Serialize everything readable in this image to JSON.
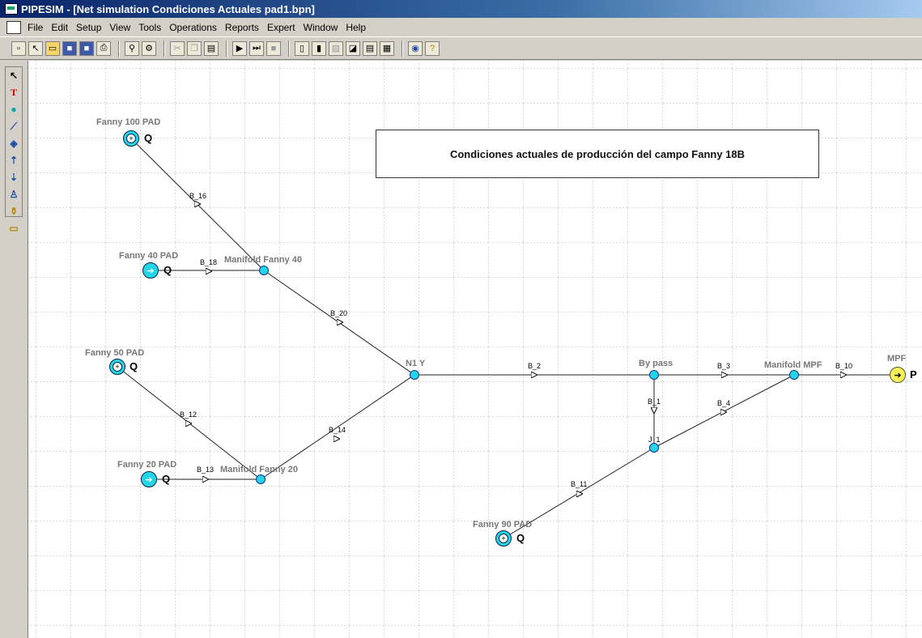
{
  "app": {
    "title": "PIPESIM - [Net simulation Condiciones Actuales pad1.bpn]"
  },
  "menu": [
    "File",
    "Edit",
    "Setup",
    "View",
    "Tools",
    "Operations",
    "Reports",
    "Expert",
    "Window",
    "Help"
  ],
  "toolbar_icons": [
    "new-icon",
    "select-icon",
    "open-icon",
    "save-icon",
    "save-as-icon",
    "print-icon",
    "find-icon",
    "properties-icon",
    "cut-icon",
    "copy-icon",
    "paste-icon",
    "run-icon",
    "run-step-icon",
    "stop-icon",
    "view-1-icon",
    "view-2-icon",
    "view-3-icon",
    "view-4-icon",
    "view-5-icon",
    "table-icon",
    "globe-icon",
    "help-icon"
  ],
  "palette_icons": [
    "pointer-tool-icon",
    "text-tool-icon",
    "junction-tool-icon",
    "branch-tool-icon",
    "source-tool-icon",
    "well-tool-icon",
    "injection-tool-icon",
    "compressor-tool-icon",
    "valve-tool-icon",
    "folder-tool-icon"
  ],
  "palette_text": {
    "text_tool": "T"
  },
  "canvas": {
    "note": "Condiciones actuales de producción del campo Fanny 18B",
    "node_labels": {
      "f100": "Fanny 100 PAD",
      "f40": "Fanny 40 PAD",
      "m40": "Manifold Fanny 40",
      "f50": "Fanny 50 PAD",
      "f20": "Fanny 20 PAD",
      "m20": "Manifold Fanny 20",
      "n1y": "N1 Y",
      "bypass": "By pass",
      "mmpf": "Manifold MPF",
      "mpf": "MPF",
      "j1": "J_1",
      "f90": "Fanny 90 PAD"
    },
    "q_labels": {
      "q1": "Q",
      "q2": "Q",
      "q3": "Q",
      "q4": "Q",
      "q5": "Q",
      "p": "P"
    },
    "branch_labels": {
      "b16": "B_16",
      "b18": "B_18",
      "b20": "B_20",
      "b2": "B_2",
      "b3": "B_3",
      "b10": "B_10",
      "b1": "B_1",
      "b4": "B_4",
      "b12": "B_12",
      "b14": "B_14",
      "b13": "B_13",
      "b11": "B_11"
    },
    "colors": {
      "node": "#23d5e8",
      "sink": "#f6f05a",
      "label": "#777777"
    }
  }
}
